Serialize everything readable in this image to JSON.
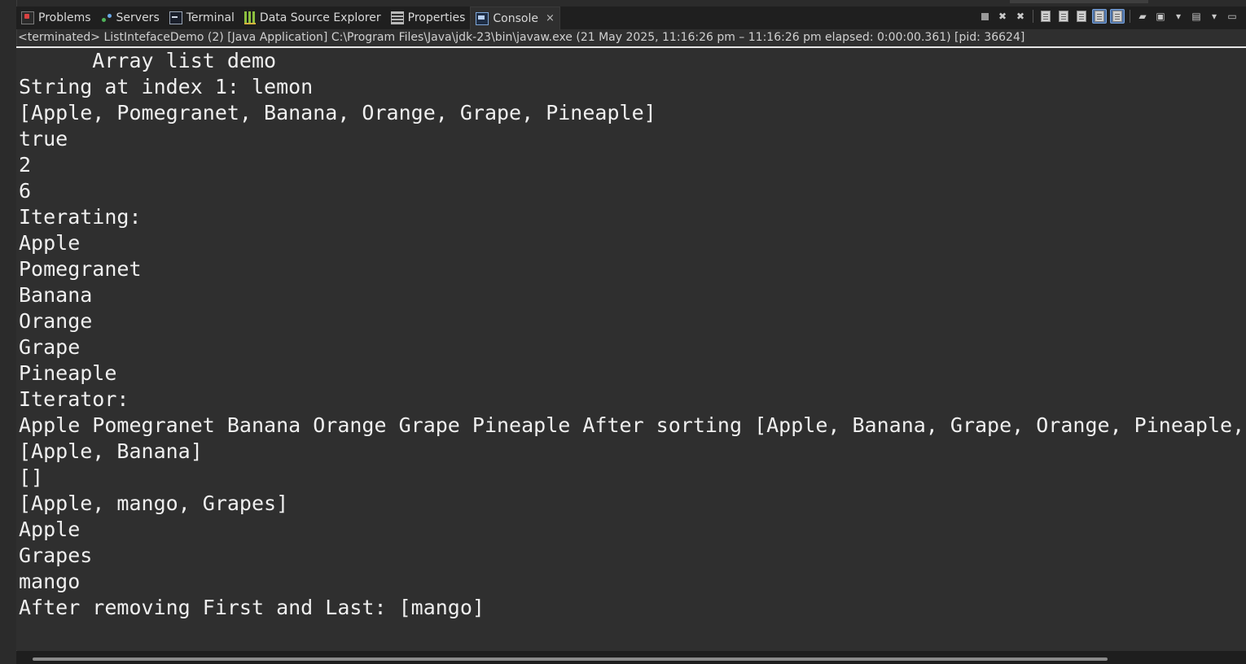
{
  "tabs": [
    {
      "label": "Problems",
      "icon": "problems-icon"
    },
    {
      "label": "Servers",
      "icon": "servers-icon"
    },
    {
      "label": "Terminal",
      "icon": "terminal-icon"
    },
    {
      "label": "Data Source Explorer",
      "icon": "data-source-explorer-icon"
    },
    {
      "label": "Properties",
      "icon": "properties-icon"
    },
    {
      "label": "Console",
      "icon": "console-icon",
      "active": true
    }
  ],
  "console_tab_close": "×",
  "status": "<terminated> ListIntefaceDemo (2) [Java Application] C:\\Program Files\\Java\\jdk-23\\bin\\javaw.exe  (21 May 2025, 11:16:26 pm – 11:16:26 pm elapsed: 0:00:00.361) [pid: 36624]",
  "output_lines": [
    "      Array list demo",
    "String at index 1: lemon",
    "[Apple, Pomegranet, Banana, Orange, Grape, Pineaple]",
    "true",
    "2",
    "6",
    "Iterating:",
    "Apple",
    "Pomegranet",
    "Banana",
    "Orange",
    "Grape",
    "Pineaple",
    "Iterator:",
    "Apple Pomegranet Banana Orange Grape Pineaple After sorting [Apple, Banana, Grape, Orange, Pineaple,",
    "[Apple, Banana]",
    "[]",
    "[Apple, mango, Grapes]",
    "Apple",
    "Grapes",
    "mango",
    "After removing First and Last: [mango]"
  ],
  "colors": {
    "console_bg": "#2f2f2f",
    "console_text": "#efefef",
    "tabbar_bg": "#1f1f1f",
    "toggle_on": "#4a6fa5"
  }
}
